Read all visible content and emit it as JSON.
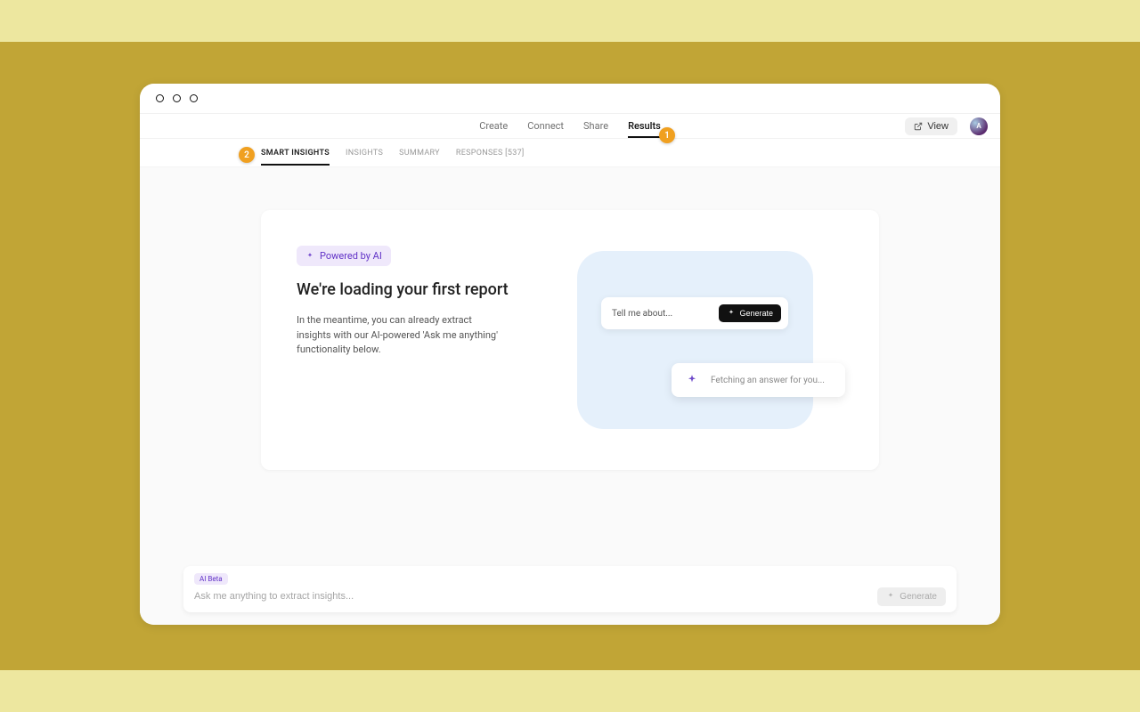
{
  "nav": {
    "tabs": [
      "Create",
      "Connect",
      "Share",
      "Results"
    ],
    "active": 3,
    "view_label": "View",
    "avatar_letter": "A"
  },
  "subnav": {
    "tabs": [
      "SMART INSIGHTS",
      "INSIGHTS",
      "SUMMARY",
      "RESPONSES [537]"
    ],
    "active": 0
  },
  "card": {
    "ai_badge": "Powered by AI",
    "title": "We're loading your first report",
    "body": "In the meantime, you can already extract insights with our AI-powered 'Ask me anything' functionality below.",
    "prompt_text": "Tell me about...",
    "generate_mini": "Generate",
    "fetching": "Fetching an answer for you..."
  },
  "askbar": {
    "beta": "AI Beta",
    "placeholder": "Ask me anything to extract insights...",
    "generate": "Generate"
  },
  "callouts": {
    "one": "1",
    "two": "2"
  }
}
